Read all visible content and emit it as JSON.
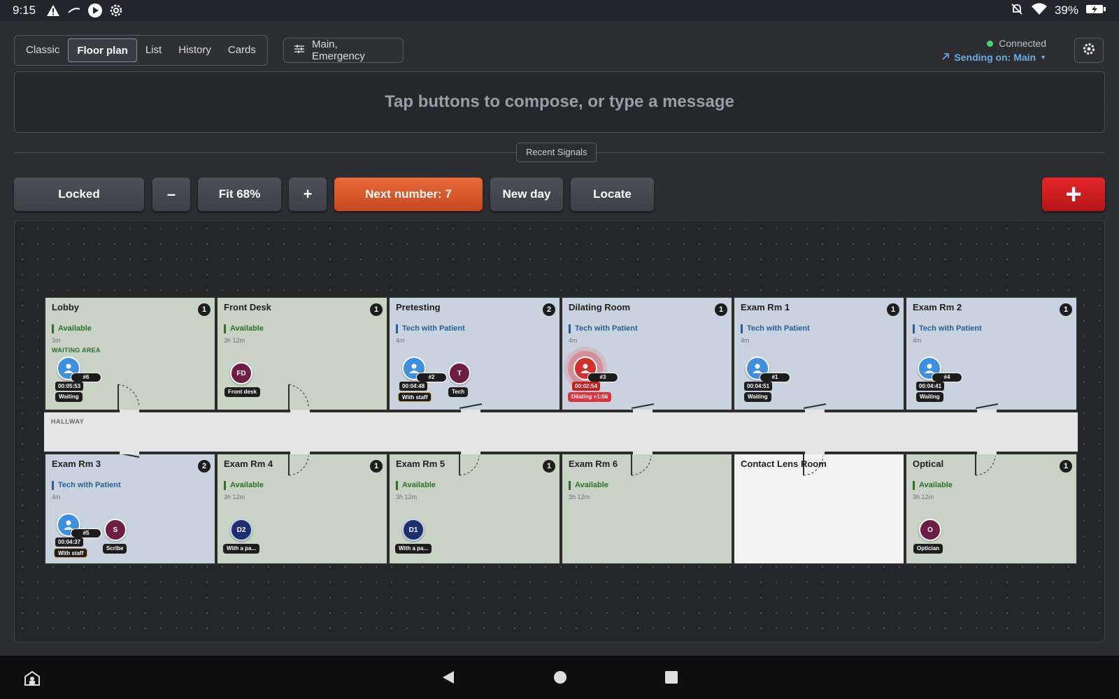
{
  "statusbar": {
    "time": "9:15",
    "battery": "39%",
    "icons": [
      "warning-icon",
      "cast-icon",
      "play-icon",
      "gear-icon",
      "notifications-off-icon",
      "wifi-icon",
      "battery-charging-icon"
    ]
  },
  "modes": [
    "Classic",
    "Floor plan",
    "List",
    "History",
    "Cards"
  ],
  "active_mode": "Floor plan",
  "filter_label": "Main, Emergency",
  "connection": {
    "status": "Connected",
    "sending": "Sending on: Main",
    "status_color": "#4bd17a",
    "link_color": "#6aaee8"
  },
  "compose_placeholder": "Tap buttons to compose, or type a message",
  "recent_signals_label": "Recent Signals",
  "controls": {
    "locked": "Locked",
    "zoom_out": "–",
    "fit": "Fit 68%",
    "zoom_in": "+",
    "next_number": "Next number: 7",
    "new_day": "New day",
    "locate": "Locate",
    "add": "+"
  },
  "colors": {
    "accent_orange": "#e0582b",
    "alert_red": "#d0191c",
    "available_green": "#2e6e2e",
    "tech_blue": "#2b5c96"
  },
  "hallway_label": "HALLWAY",
  "rooms": {
    "lobby": {
      "name": "Lobby",
      "count": "1",
      "status": "Available",
      "elapsed": "3m",
      "area": "WAITING AREA",
      "patient": {
        "num": "#6",
        "timer": "00:05:53",
        "tag": "Waiting"
      }
    },
    "front_desk": {
      "name": "Front Desk",
      "count": "1",
      "status": "Available",
      "elapsed": "3h 12m",
      "staff": {
        "initials": "FD",
        "tag": "Front desk"
      }
    },
    "pretesting": {
      "name": "Pretesting",
      "count": "2",
      "status": "Tech with Patient",
      "elapsed": "4m",
      "patient": {
        "num": "#2",
        "timer": "00:04:48",
        "tag": "With staff"
      },
      "staff": {
        "initials": "T",
        "tag": "Tech"
      }
    },
    "dilating": {
      "name": "Dilating Room",
      "count": "1",
      "status": "Tech with Patient",
      "elapsed": "4m",
      "patient": {
        "num": "#3",
        "timer": "00:02:54",
        "tag": "Dilating +1:56"
      }
    },
    "exam1": {
      "name": "Exam Rm 1",
      "count": "1",
      "status": "Tech with Patient",
      "elapsed": "4m",
      "patient": {
        "num": "#1",
        "timer": "00:04:51",
        "tag": "Waiting"
      }
    },
    "exam2": {
      "name": "Exam Rm 2",
      "count": "1",
      "status": "Tech with Patient",
      "elapsed": "4m",
      "patient": {
        "num": "#4",
        "timer": "00:04:41",
        "tag": "Waiting"
      }
    },
    "exam3": {
      "name": "Exam Rm 3",
      "count": "2",
      "status": "Tech with Patient",
      "elapsed": "4m",
      "patient": {
        "num": "#5",
        "timer": "00:04:37",
        "tag": "With staff"
      },
      "staff": {
        "initials": "S",
        "tag": "Scribe"
      }
    },
    "exam4": {
      "name": "Exam Rm 4",
      "count": "1",
      "status": "Available",
      "elapsed": "3h 12m",
      "staff": {
        "initials": "D2",
        "tag": "With a pa..."
      }
    },
    "exam5": {
      "name": "Exam Rm 5",
      "count": "1",
      "status": "Available",
      "elapsed": "3h 12m",
      "staff": {
        "initials": "D1",
        "tag": "With a pa..."
      }
    },
    "exam6": {
      "name": "Exam Rm 6",
      "status": "Available",
      "elapsed": "3h 12m"
    },
    "contact": {
      "name": "Contact Lens Room"
    },
    "optical": {
      "name": "Optical",
      "count": "1",
      "status": "Available",
      "elapsed": "3h 12m",
      "staff": {
        "initials": "O",
        "tag": "Optician"
      }
    }
  }
}
